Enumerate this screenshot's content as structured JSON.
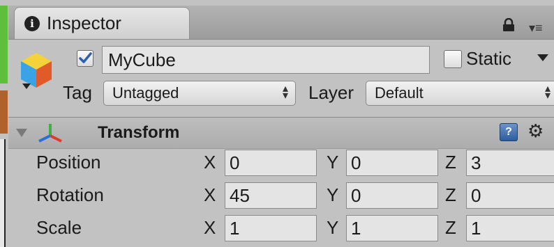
{
  "tab": {
    "title": "Inspector",
    "info_icon": "info-icon"
  },
  "header": {
    "active": true,
    "name": "MyCube",
    "static_label": "Static",
    "static_checked": false,
    "tag_label": "Tag",
    "tag_value": "Untagged",
    "layer_label": "Layer",
    "layer_value": "Default"
  },
  "component": {
    "title": "Transform",
    "help_glyph": "?",
    "gear_glyph": "⚙",
    "rows": [
      {
        "label": "Position",
        "x": "0",
        "y": "0",
        "z": "3"
      },
      {
        "label": "Rotation",
        "x": "45",
        "y": "0",
        "z": "0"
      },
      {
        "label": "Scale",
        "x": "1",
        "y": "1",
        "z": "1"
      }
    ],
    "axis_labels": {
      "x": "X",
      "y": "Y",
      "z": "Z"
    }
  },
  "colors": {
    "panel_bg": "#c2c2c2",
    "field_bg": "#e4e4e4",
    "check_blue": "#2f5fb0",
    "help_blue": "#2d5c9e"
  }
}
